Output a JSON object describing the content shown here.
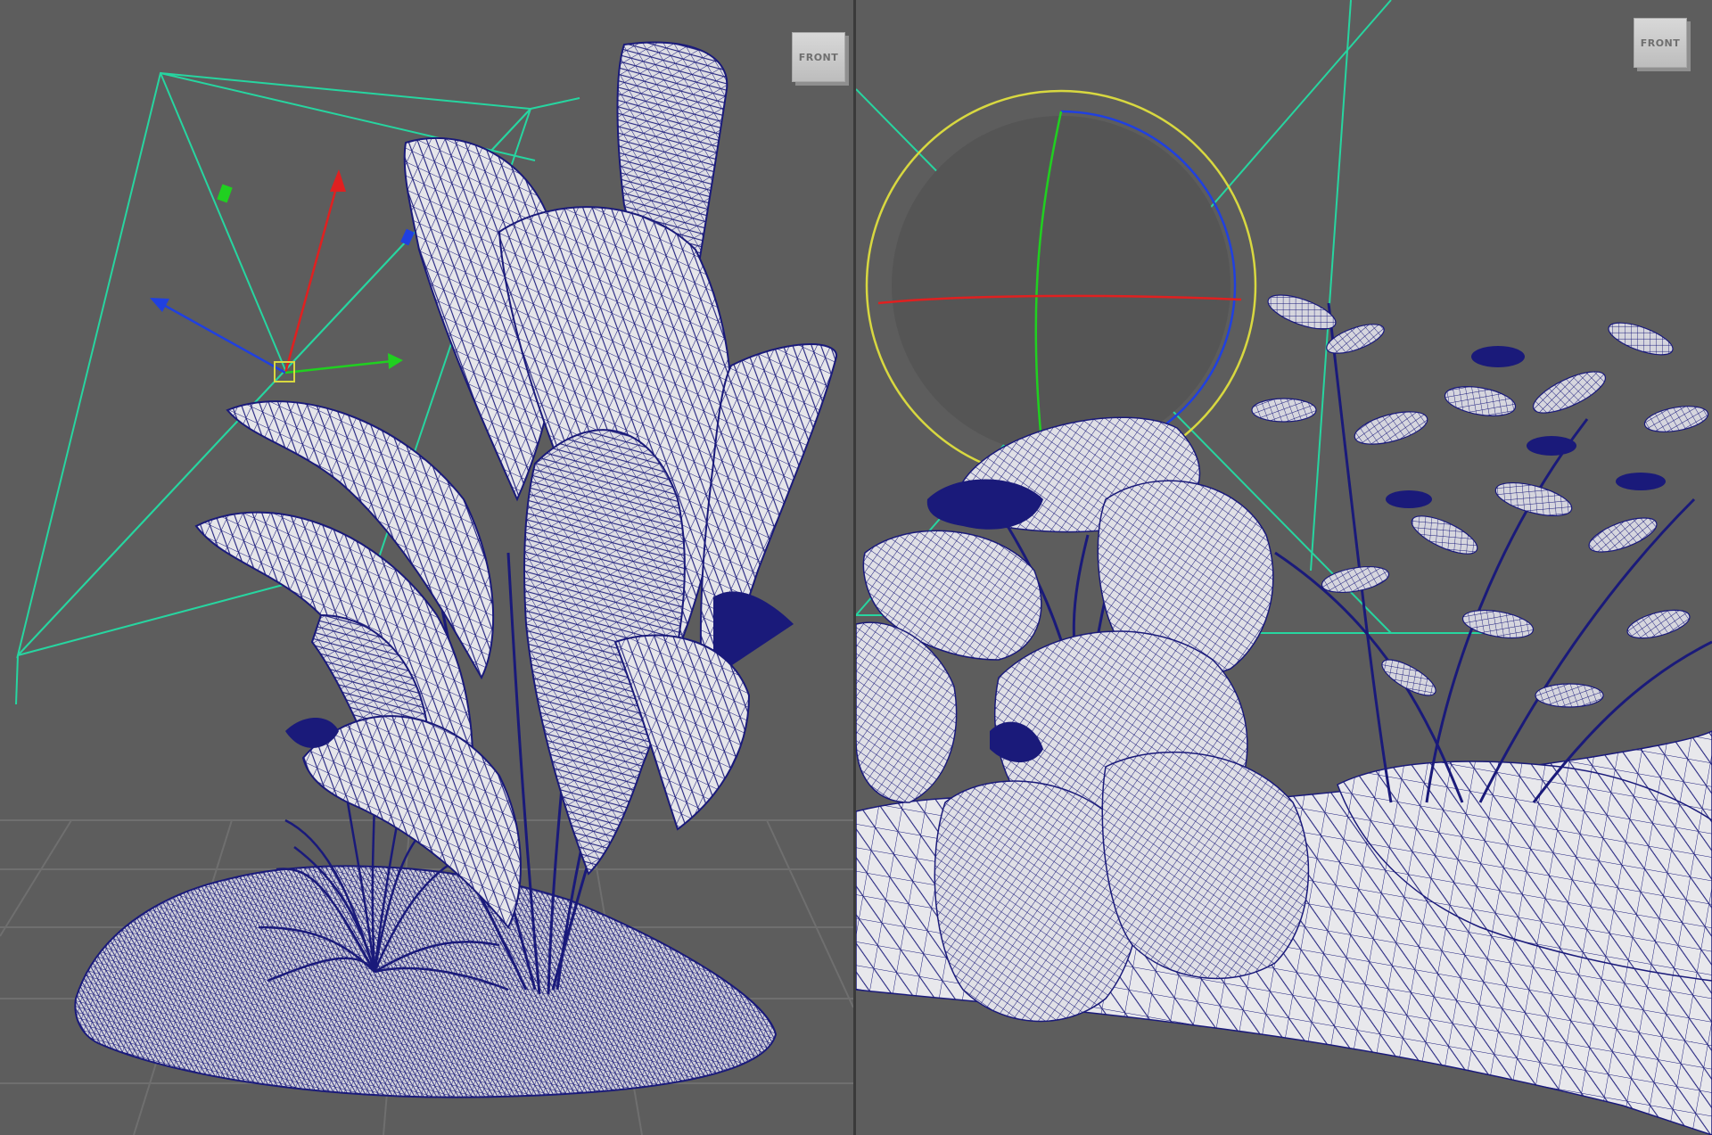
{
  "viewports": [
    {
      "id": "viewport-left",
      "viewcube_label": "FRONT"
    },
    {
      "id": "viewport-right",
      "viewcube_label": "FRONT"
    }
  ],
  "colors": {
    "viewport_bg": "#5d5d5d",
    "wire": "#1a1a7a",
    "mesh_fill": "#e6e6ea",
    "camera_frustum": "#27d5a0",
    "axis_x": "#e02020",
    "axis_y": "#20d020",
    "axis_z": "#2040e0",
    "rotate_ring_outer": "#d8d840",
    "grid": "#6c6c6c"
  },
  "icons": {
    "move_manipulator": "move-gizmo-icon",
    "rotate_manipulator": "rotate-gizmo-icon",
    "viewcube": "viewcube-icon"
  }
}
